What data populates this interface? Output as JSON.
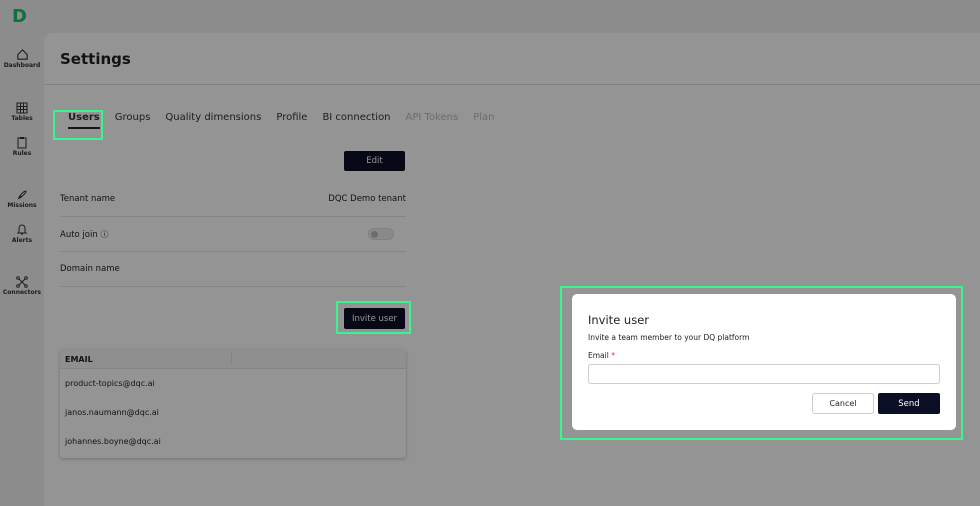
{
  "sidebar": {
    "logo": "D",
    "items": [
      {
        "label": "Dashboard",
        "icon": "home-icon"
      },
      {
        "label": "Tables",
        "icon": "grid-icon"
      },
      {
        "label": "Rules",
        "icon": "clipboard-icon"
      },
      {
        "label": "Missions",
        "icon": "rocket-icon"
      },
      {
        "label": "Alerts",
        "icon": "bell-icon"
      },
      {
        "label": "Connectors",
        "icon": "connectors-icon"
      }
    ]
  },
  "header": {
    "title": "Settings"
  },
  "tabs": [
    {
      "label": "Users"
    },
    {
      "label": "Groups"
    },
    {
      "label": "Quality dimensions"
    },
    {
      "label": "Profile"
    },
    {
      "label": "BI connection"
    },
    {
      "label": "API Tokens"
    },
    {
      "label": "Plan"
    }
  ],
  "users": {
    "edit_label": "Edit",
    "tenant_label": "Tenant name",
    "tenant_value": "DQC Demo tenant",
    "auto_join_label": "Auto join",
    "auto_join_on": false,
    "domain_label": "Domain name",
    "invite_label": "Invite user",
    "table": {
      "header": "EMAIL",
      "rows": [
        "product-topics@dqc.ai",
        "janos.naumann@dqc.ai",
        "johannes.boyne@dqc.ai"
      ]
    }
  },
  "dialog": {
    "title": "Invite user",
    "subtitle": "Invite a team member to your DQ platform",
    "email_label": "Email",
    "required": "*",
    "email_value": "",
    "cancel": "Cancel",
    "send": "Send"
  }
}
